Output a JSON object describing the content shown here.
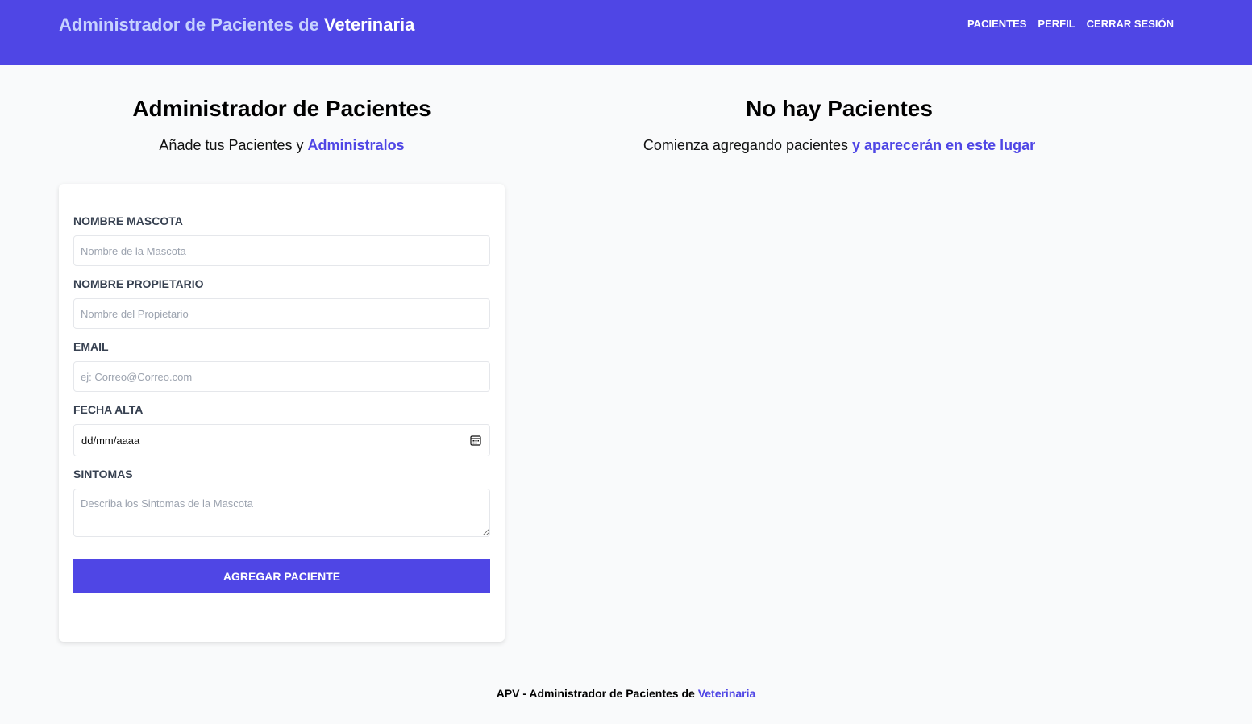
{
  "header": {
    "brand_prefix": "Administrador de Pacientes de ",
    "brand_strong": "Veterinaria",
    "nav": [
      "PACIENTES",
      "PERFIL",
      "CERRAR SESIÓN"
    ]
  },
  "left": {
    "title": "Administrador de Pacientes",
    "subtitle_prefix": "Añade tus Pacientes y ",
    "subtitle_accent": "Administralos"
  },
  "right": {
    "title": "No hay Pacientes",
    "subtitle_prefix": "Comienza agregando pacientes ",
    "subtitle_accent": "y aparecerán en este lugar"
  },
  "form": {
    "mascota_label": "Nombre Mascota",
    "mascota_placeholder": "Nombre de la Mascota",
    "propietario_label": "Nombre Propietario",
    "propietario_placeholder": "Nombre del Propietario",
    "email_label": "Email",
    "email_placeholder": "ej: Correo@Correo.com",
    "fecha_label": "Fecha Alta",
    "fecha_value": "dd/mm/aaaa",
    "sintomas_label": "Sintomas",
    "sintomas_placeholder": "Describa los Sintomas de la Mascota",
    "submit_label": "Agregar Paciente"
  },
  "footer": {
    "prefix": "APV - Administrador de Pacientes de ",
    "accent": "Veterinaria"
  },
  "colors": {
    "primary": "#4f46e5",
    "background": "#f9fafb",
    "label": "#374151"
  },
  "icons": {
    "date_picker": "calendar-icon"
  }
}
